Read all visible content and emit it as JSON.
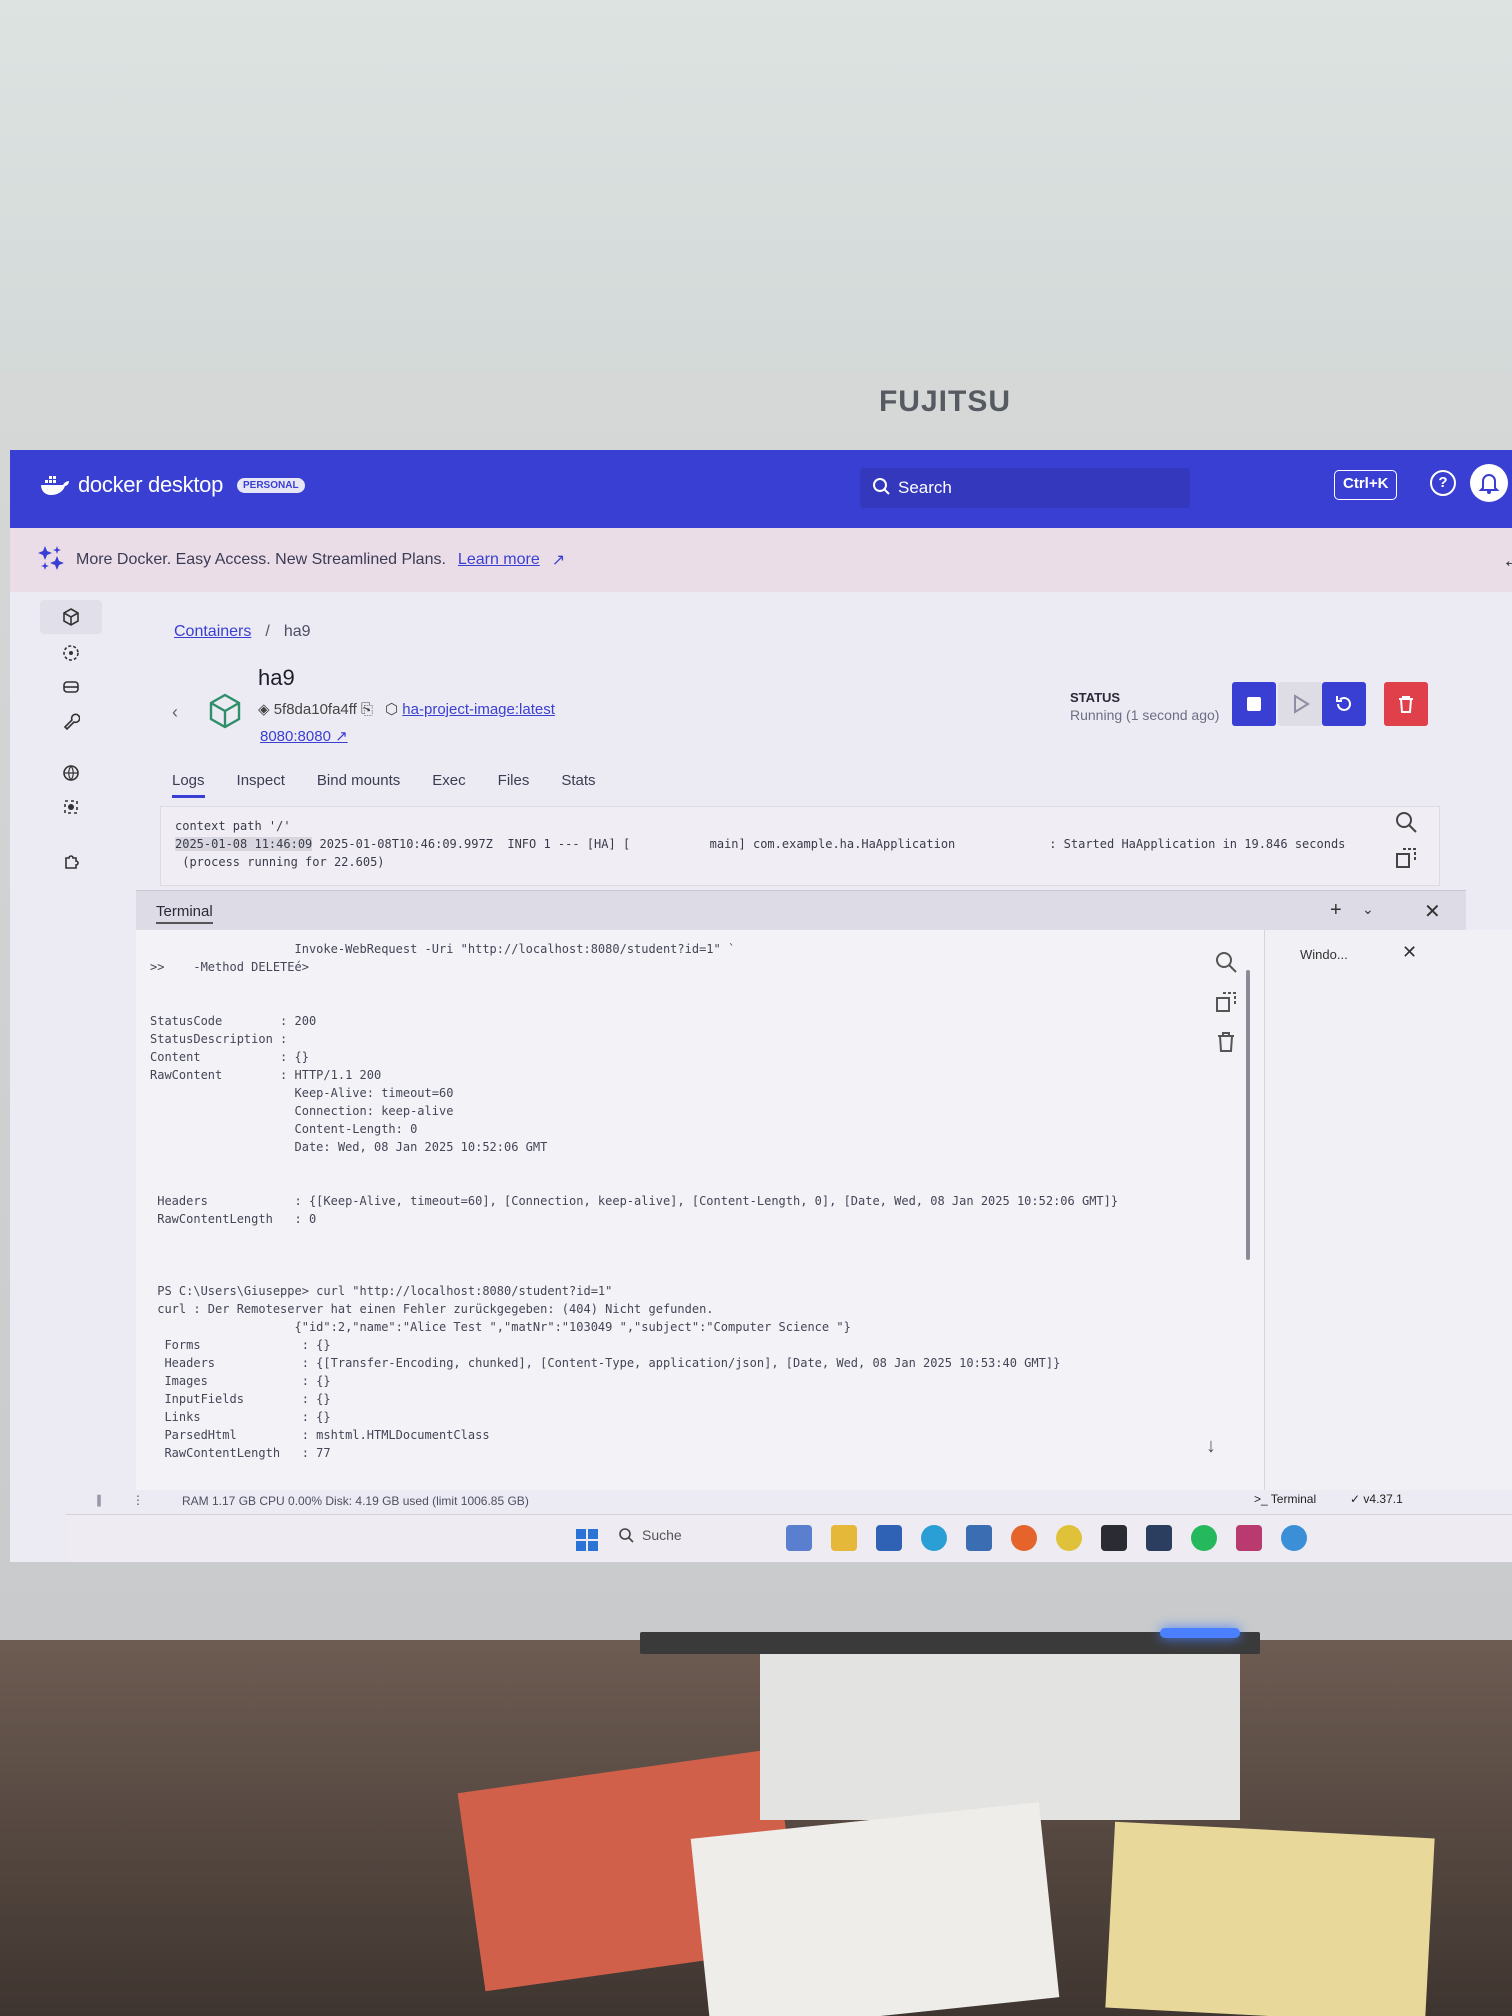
{
  "monitor_brand": "FUJITSU",
  "app": {
    "name": "docker desktop",
    "plan_badge": "PERSONAL",
    "search_label": "Search",
    "shortcut": "Ctrl+K"
  },
  "promo": {
    "text": "More Docker. Easy Access. New Streamlined Plans.",
    "link": "Learn more"
  },
  "breadcrumb": {
    "root": "Containers",
    "sep": "/",
    "current": "ha9"
  },
  "container": {
    "name": "ha9",
    "id": "5f8da10fa4ff",
    "image": "ha-project-image:latest",
    "port": "8080:8080",
    "status_label": "STATUS",
    "status_value": "Running (1 second ago)"
  },
  "tabs": [
    "Logs",
    "Inspect",
    "Bind mounts",
    "Exec",
    "Files",
    "Stats"
  ],
  "logs": {
    "line1": "context path '/'",
    "ts": "2025-01-08 11:46:09",
    "line2": " 2025-01-08T10:46:09.997Z  INFO 1 --- [HA] [           main] com.example.ha.HaApplication             : Started HaApplication in 19.846 seconds",
    "line3": " (process running for 22.605)"
  },
  "terminal": {
    "tab": "Terminal",
    "side_panel_label": "Windo...",
    "lines": [
      "                    Invoke-WebRequest -Uri \"http://localhost:8080/student?id=1\" `",
      ">>    -Method DELETEé>",
      "",
      "",
      "StatusCode        : 200",
      "StatusDescription :",
      "Content           : {}",
      "RawContent        : HTTP/1.1 200",
      "                    Keep-Alive: timeout=60",
      "                    Connection: keep-alive",
      "                    Content-Length: 0",
      "                    Date: Wed, 08 Jan 2025 10:52:06 GMT",
      "",
      "",
      " Headers            : {[Keep-Alive, timeout=60], [Connection, keep-alive], [Content-Length, 0], [Date, Wed, 08 Jan 2025 10:52:06 GMT]}",
      " RawContentLength   : 0",
      "",
      "",
      "",
      " PS C:\\Users\\Giuseppe> curl \"http://localhost:8080/student?id=1\"",
      " curl : Der Remoteserver hat einen Fehler zurückgegeben: (404) Nicht gefunden.",
      "                    {\"id\":2,\"name\":\"Alice Test \",\"matNr\":\"103049 \",\"subject\":\"Computer Science \"}",
      "  Forms              : {}",
      "  Headers            : {[Transfer-Encoding, chunked], [Content-Type, application/json], [Date, Wed, 08 Jan 2025 10:53:40 GMT]}",
      "  Images             : {}",
      "  InputFields        : {}",
      "  Links              : {}",
      "  ParsedHtml         : mshtml.HTMLDocumentClass",
      "  RawContentLength   : 77"
    ]
  },
  "footer": {
    "stats": "RAM 1.17 GB  CPU 0.00%   Disk: 4.19 GB used (limit 1006.85 GB)",
    "terminal": ">_ Terminal",
    "version": "✓ v4.37.1"
  },
  "taskbar": {
    "search": "Suche"
  },
  "colors": {
    "docker_blue": "#3a3fd3",
    "stop": "#3a3fd3",
    "delete": "#e0404a"
  }
}
